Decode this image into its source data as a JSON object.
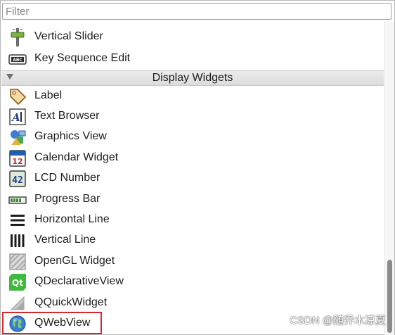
{
  "filter": {
    "placeholder": "Filter",
    "value": ""
  },
  "items_top": [
    {
      "label": "Vertical Slider",
      "icon": "vertical-slider-icon"
    },
    {
      "label": "Key Sequence Edit",
      "icon": "key-sequence-edit-icon"
    }
  ],
  "category": {
    "label": "Display Widgets",
    "state": "expanded"
  },
  "items": [
    {
      "label": "Label",
      "icon": "label-tag-icon"
    },
    {
      "label": "Text Browser",
      "icon": "text-browser-icon"
    },
    {
      "label": "Graphics View",
      "icon": "graphics-view-icon"
    },
    {
      "label": "Calendar Widget",
      "icon": "calendar-icon",
      "icon_text": "12"
    },
    {
      "label": "LCD Number",
      "icon": "lcd-number-icon",
      "icon_text": "42"
    },
    {
      "label": "Progress Bar",
      "icon": "progress-bar-icon"
    },
    {
      "label": "Horizontal Line",
      "icon": "horizontal-line-icon"
    },
    {
      "label": "Vertical Line",
      "icon": "vertical-line-icon"
    },
    {
      "label": "OpenGL Widget",
      "icon": "opengl-widget-icon"
    },
    {
      "label": "QDeclarativeView",
      "icon": "qt-logo-icon",
      "icon_text": "Qt"
    },
    {
      "label": "QQuickWidget",
      "icon": "qquick-widget-icon"
    },
    {
      "label": "QWebView",
      "icon": "globe-icon"
    }
  ],
  "highlight": {
    "target": "QWebView",
    "color": "#d9272e"
  },
  "watermark": "CSDN @随乔木凉夏",
  "colors": {
    "category_bg": "#e2e2e2",
    "scroll_thumb": "#8b8b8b"
  }
}
